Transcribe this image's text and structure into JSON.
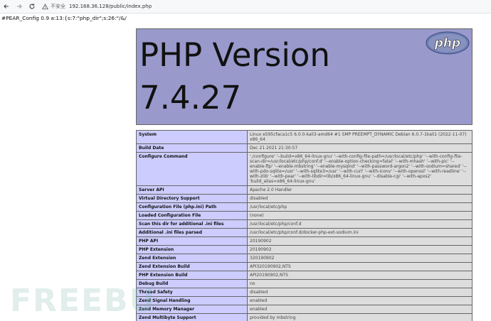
{
  "browser": {
    "security_label": "不安全",
    "url": "192.168.36.128/public/index.php"
  },
  "pear_config": "#PEAR_Config 0.9 a:13:{s:7:\"php_dir\";s:26:\"/&/",
  "header": {
    "title_line1": "PHP Version",
    "title_line2": "7.4.27",
    "logo_text": "php"
  },
  "rows": [
    {
      "key": "System",
      "value": "Linux e595cfaca1c5 6.0.0-kali3-amd64 #1 SMP PREEMPT_DYNAMIC Debian 6.0.7-1kali1 (2022-11-07) x86_64"
    },
    {
      "key": "Build Date",
      "value": "Dec 21 2021 21:30:57"
    },
    {
      "key": "Configure Command",
      "value": "'./configure' '--build=x86_64-linux-gnu' '--with-config-file-path=/usr/local/etc/php' '--with-config-file-scan-dir=/usr/local/etc/php/conf.d' '--enable-option-checking=fatal' '--with-mhash' '--with-pic' '--enable-ftp' '--enable-mbstring' '--enable-mysqlnd' '--with-password-argon2' '--with-sodium=shared' '--with-pdo-sqlite=/usr' '--with-sqlite3=/usr' '--with-curl' '--with-iconv' '--with-openssl' '--with-readline' '--with-zlib' '--with-pear' '--with-libdir=lib/x86_64-linux-gnu' '--disable-cgi' '--with-apxs2' 'build_alias=x86_64-linux-gnu'"
    },
    {
      "key": "Server API",
      "value": "Apache 2.0 Handler"
    },
    {
      "key": "Virtual Directory Support",
      "value": "disabled"
    },
    {
      "key": "Configuration File (php.ini) Path",
      "value": "/usr/local/etc/php"
    },
    {
      "key": "Loaded Configuration File",
      "value": "(none)"
    },
    {
      "key": "Scan this dir for additional .ini files",
      "value": "/usr/local/etc/php/conf.d"
    },
    {
      "key": "Additional .ini files parsed",
      "value": "/usr/local/etc/php/conf.d/docker-php-ext-sodium.ini"
    },
    {
      "key": "PHP API",
      "value": "20190902"
    },
    {
      "key": "PHP Extension",
      "value": "20190902"
    },
    {
      "key": "Zend Extension",
      "value": "320190902"
    },
    {
      "key": "Zend Extension Build",
      "value": "API320190902,NTS"
    },
    {
      "key": "PHP Extension Build",
      "value": "API20190902,NTS"
    },
    {
      "key": "Debug Build",
      "value": "no"
    },
    {
      "key": "Thread Safety",
      "value": "disabled"
    },
    {
      "key": "Zend Signal Handling",
      "value": "enabled"
    },
    {
      "key": "Zend Memory Manager",
      "value": "enabled"
    },
    {
      "key": "Zend Multibyte Support",
      "value": "provided by mbstring"
    }
  ],
  "watermark": "FREEBU",
  "colors": {
    "header_bg": "#9999cc",
    "key_bg": "#ccccff",
    "value_bg": "#dddddd"
  }
}
